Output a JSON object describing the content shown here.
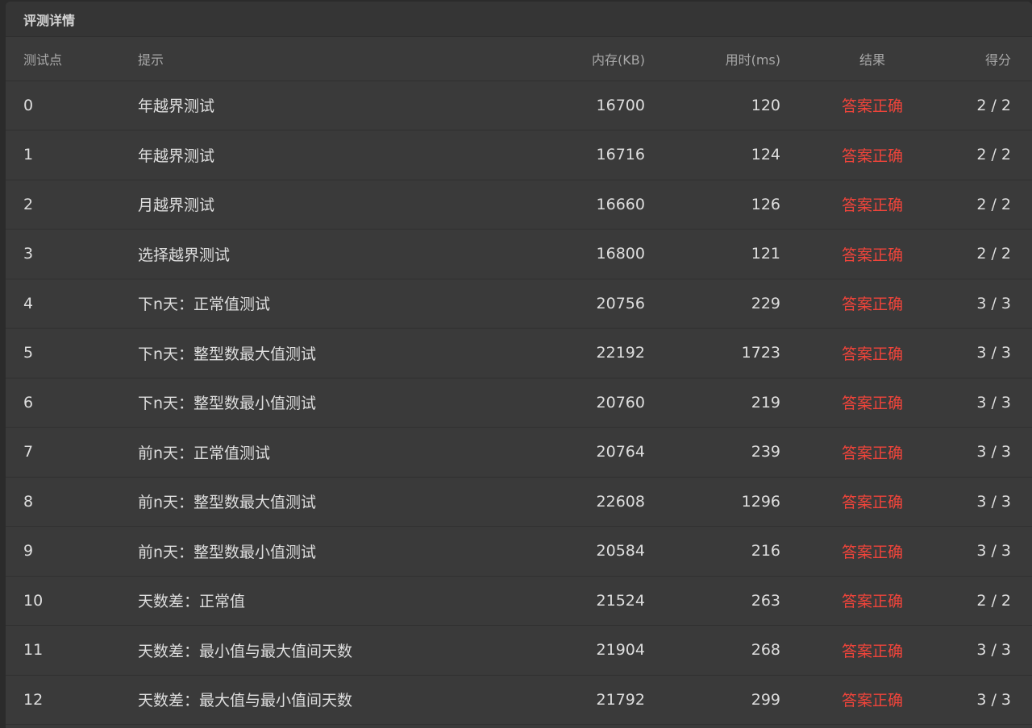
{
  "panel": {
    "title": "评测详情"
  },
  "table": {
    "headers": {
      "index": "测试点",
      "hint": "提示",
      "memory": "内存(KB)",
      "time": "用时(ms)",
      "result": "结果",
      "score": "得分"
    },
    "rows": [
      {
        "index": "0",
        "hint": "年越界测试",
        "memory": "16700",
        "time": "120",
        "result": "答案正确",
        "score": "2 / 2"
      },
      {
        "index": "1",
        "hint": "年越界测试",
        "memory": "16716",
        "time": "124",
        "result": "答案正确",
        "score": "2 / 2"
      },
      {
        "index": "2",
        "hint": "月越界测试",
        "memory": "16660",
        "time": "126",
        "result": "答案正确",
        "score": "2 / 2"
      },
      {
        "index": "3",
        "hint": "选择越界测试",
        "memory": "16800",
        "time": "121",
        "result": "答案正确",
        "score": "2 / 2"
      },
      {
        "index": "4",
        "hint": "下n天：正常值测试",
        "memory": "20756",
        "time": "229",
        "result": "答案正确",
        "score": "3 / 3"
      },
      {
        "index": "5",
        "hint": "下n天：整型数最大值测试",
        "memory": "22192",
        "time": "1723",
        "result": "答案正确",
        "score": "3 / 3"
      },
      {
        "index": "6",
        "hint": "下n天：整型数最小值测试",
        "memory": "20760",
        "time": "219",
        "result": "答案正确",
        "score": "3 / 3"
      },
      {
        "index": "7",
        "hint": "前n天：正常值测试",
        "memory": "20764",
        "time": "239",
        "result": "答案正确",
        "score": "3 / 3"
      },
      {
        "index": "8",
        "hint": "前n天：整型数最大值测试",
        "memory": "22608",
        "time": "1296",
        "result": "答案正确",
        "score": "3 / 3"
      },
      {
        "index": "9",
        "hint": "前n天：整型数最小值测试",
        "memory": "20584",
        "time": "216",
        "result": "答案正确",
        "score": "3 / 3"
      },
      {
        "index": "10",
        "hint": "天数差：正常值",
        "memory": "21524",
        "time": "263",
        "result": "答案正确",
        "score": "2 / 2"
      },
      {
        "index": "11",
        "hint": "天数差：最小值与最大值间天数",
        "memory": "21904",
        "time": "268",
        "result": "答案正确",
        "score": "3 / 3"
      },
      {
        "index": "12",
        "hint": "天数差：最大值与最小值间天数",
        "memory": "21792",
        "time": "299",
        "result": "答案正确",
        "score": "3 / 3"
      }
    ]
  },
  "colors": {
    "result_ok": "#f0443a"
  }
}
